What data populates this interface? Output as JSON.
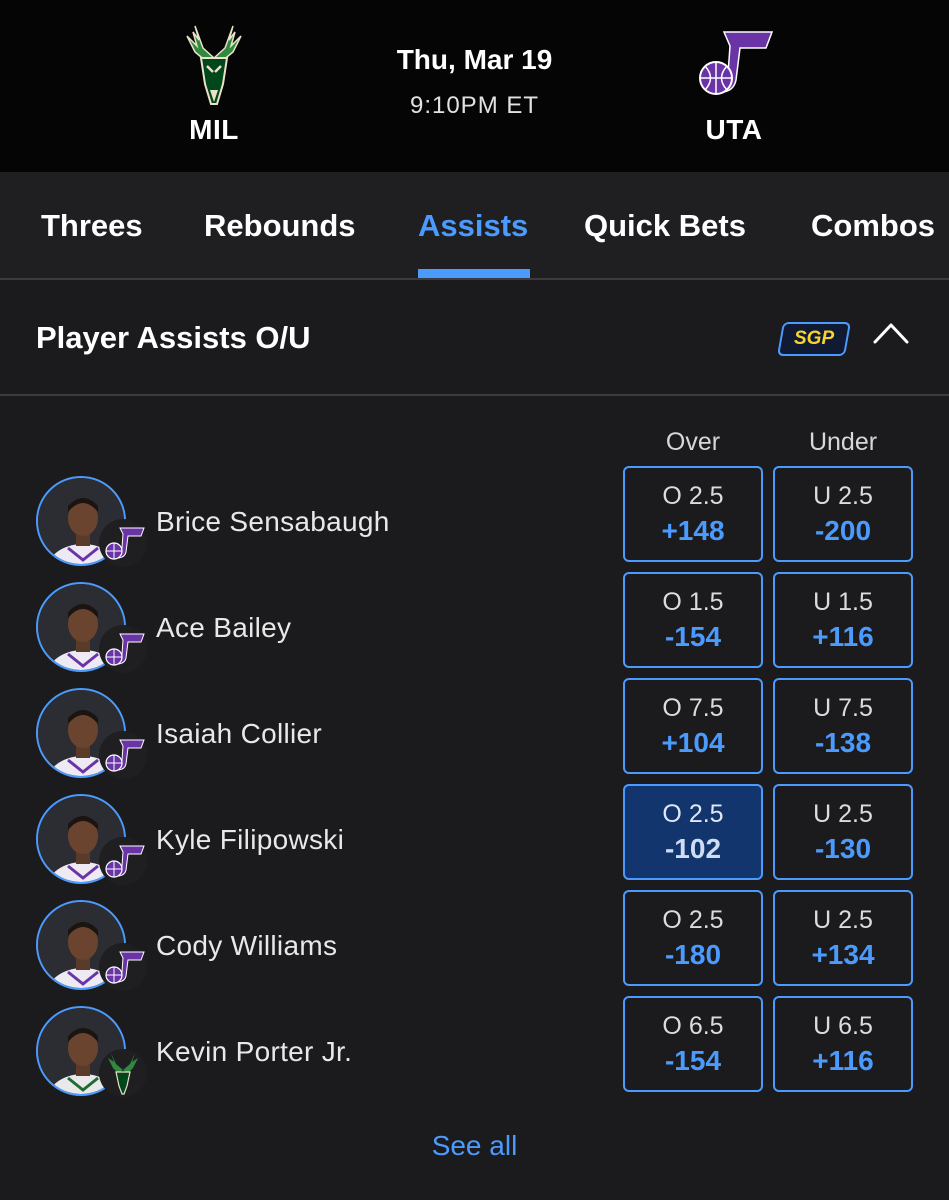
{
  "game": {
    "home": {
      "abbr": "MIL",
      "logo": "bucks-deer-logo",
      "color": "#00471b"
    },
    "away": {
      "abbr": "UTA",
      "logo": "jazz-note-logo",
      "color": "#5b2b8c"
    },
    "date": "Thu, Mar 19",
    "time": "9:10PM ET"
  },
  "tabs": [
    {
      "label": "Threes",
      "active": false
    },
    {
      "label": "Rebounds",
      "active": false
    },
    {
      "label": "Assists",
      "active": true
    },
    {
      "label": "Quick Bets",
      "active": false
    },
    {
      "label": "Combos",
      "active": false
    }
  ],
  "market": {
    "title": "Player Assists O/U",
    "badge": "SGP",
    "collapse_icon": "chevron-up-icon",
    "columns": {
      "over": "Over",
      "under": "Under"
    },
    "players": [
      {
        "name": "Brice Sensabaugh",
        "team": "UTA",
        "over": {
          "line": "O 2.5",
          "price": "+148",
          "selected": false
        },
        "under": {
          "line": "U 2.5",
          "price": "-200",
          "selected": false
        }
      },
      {
        "name": "Ace Bailey",
        "team": "UTA",
        "over": {
          "line": "O 1.5",
          "price": "-154",
          "selected": false
        },
        "under": {
          "line": "U 1.5",
          "price": "+116",
          "selected": false
        }
      },
      {
        "name": "Isaiah Collier",
        "team": "UTA",
        "over": {
          "line": "O 7.5",
          "price": "+104",
          "selected": false
        },
        "under": {
          "line": "U 7.5",
          "price": "-138",
          "selected": false
        }
      },
      {
        "name": "Kyle Filipowski",
        "team": "UTA",
        "over": {
          "line": "O 2.5",
          "price": "-102",
          "selected": true
        },
        "under": {
          "line": "U 2.5",
          "price": "-130",
          "selected": false
        }
      },
      {
        "name": "Cody Williams",
        "team": "UTA",
        "over": {
          "line": "O 2.5",
          "price": "-180",
          "selected": false
        },
        "under": {
          "line": "U 2.5",
          "price": "+134",
          "selected": false
        }
      },
      {
        "name": "Kevin Porter Jr.",
        "team": "MIL",
        "over": {
          "line": "O 6.5",
          "price": "-154",
          "selected": false
        },
        "under": {
          "line": "U 6.5",
          "price": "+116",
          "selected": false
        }
      }
    ],
    "see_all": "See all"
  },
  "colors": {
    "accent": "#4b9bff",
    "selected_bg": "#12356e",
    "sgp_text": "#f7d32e",
    "background": "#1b1b1d",
    "header_bg": "#050505"
  }
}
